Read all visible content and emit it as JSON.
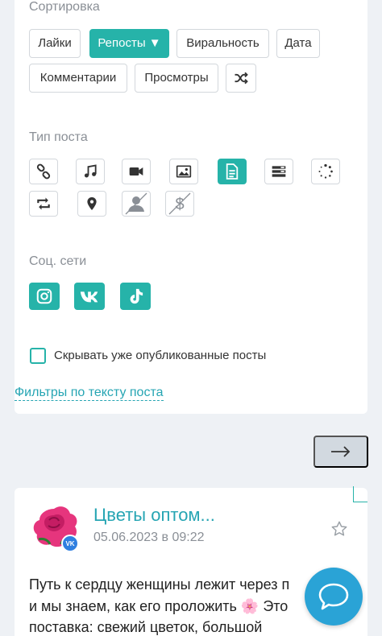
{
  "sort": {
    "label": "Сортировка",
    "options": [
      {
        "label": "Лайки",
        "active": false
      },
      {
        "label": "Репосты ▼",
        "active": true
      },
      {
        "label": "Виральность",
        "active": false
      },
      {
        "label": "Дата",
        "active": false
      },
      {
        "label": "Комментарии",
        "active": false
      },
      {
        "label": "Просмотры",
        "active": false
      }
    ],
    "shuffle_icon": "shuffle-icon"
  },
  "post_type": {
    "label": "Тип поста",
    "icons": [
      "link-icon",
      "music-icon",
      "video-icon",
      "image-icon",
      "document-icon",
      "list-icon",
      "loading-icon",
      "repost-icon",
      "location-icon",
      "no-author-icon",
      "no-ads-icon"
    ],
    "active": "document-icon"
  },
  "social": {
    "label": "Соц. сети",
    "networks": [
      "instagram-icon",
      "vk-icon",
      "tiktok-icon"
    ]
  },
  "hide_published": {
    "label": "Скрывать уже опубликованные посты",
    "checked": false
  },
  "text_filters_link": "Фильтры по тексту поста",
  "next_button": "→",
  "post": {
    "title": "Цветы оптом...",
    "date": "05.06.2023 в 09:22",
    "badge": "VK",
    "lines": [
      "Путь к сердцу женщины лежит через п",
      "и мы знаем, как его проложить 🌸 Это",
      "поставка: свежий цветок, большой"
    ]
  },
  "colors": {
    "accent": "#26b3a9",
    "link": "#26a5b3",
    "chat": "#2aa3d6"
  }
}
